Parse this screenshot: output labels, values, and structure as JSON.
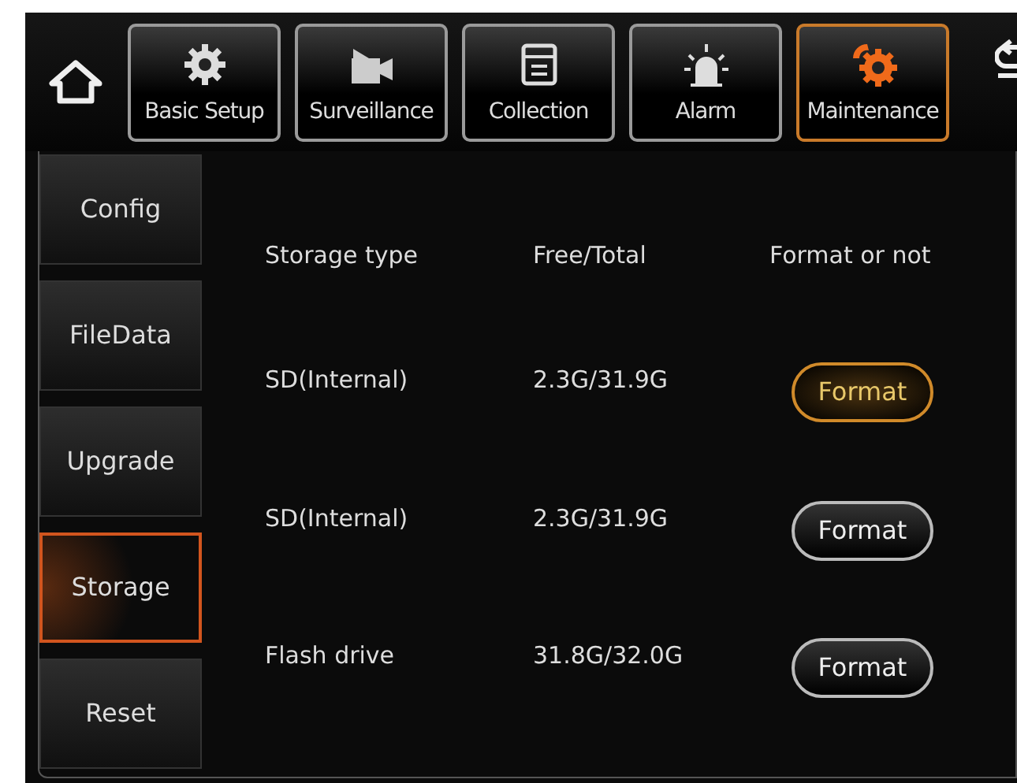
{
  "top_bar": {
    "tabs": [
      {
        "label": "Basic Setup",
        "kind": "gear",
        "selected": false
      },
      {
        "label": "Surveillance",
        "kind": "camera",
        "selected": false
      },
      {
        "label": "Collection",
        "kind": "document",
        "selected": false
      },
      {
        "label": "Alarm",
        "kind": "alarm",
        "selected": false
      },
      {
        "label": "Maintenance",
        "kind": "maintenance",
        "selected": true
      }
    ]
  },
  "sidebar": {
    "items": [
      {
        "label": "Config",
        "selected": false
      },
      {
        "label": "FileData",
        "selected": false
      },
      {
        "label": "Upgrade",
        "selected": false
      },
      {
        "label": "Storage",
        "selected": true
      },
      {
        "label": "Reset",
        "selected": false
      }
    ]
  },
  "table": {
    "columns": [
      "Storage type",
      "Free/Total",
      "Format or not"
    ],
    "rows": [
      {
        "storage_type": "SD(Internal)",
        "free_total": "2.3G/31.9G",
        "button": "Format",
        "selected": true
      },
      {
        "storage_type": "SD(Internal)",
        "free_total": "2.3G/31.9G",
        "button": "Format",
        "selected": false
      },
      {
        "storage_type": "Flash drive",
        "free_total": "31.8G/32.0G",
        "button": "Format",
        "selected": false
      }
    ]
  }
}
